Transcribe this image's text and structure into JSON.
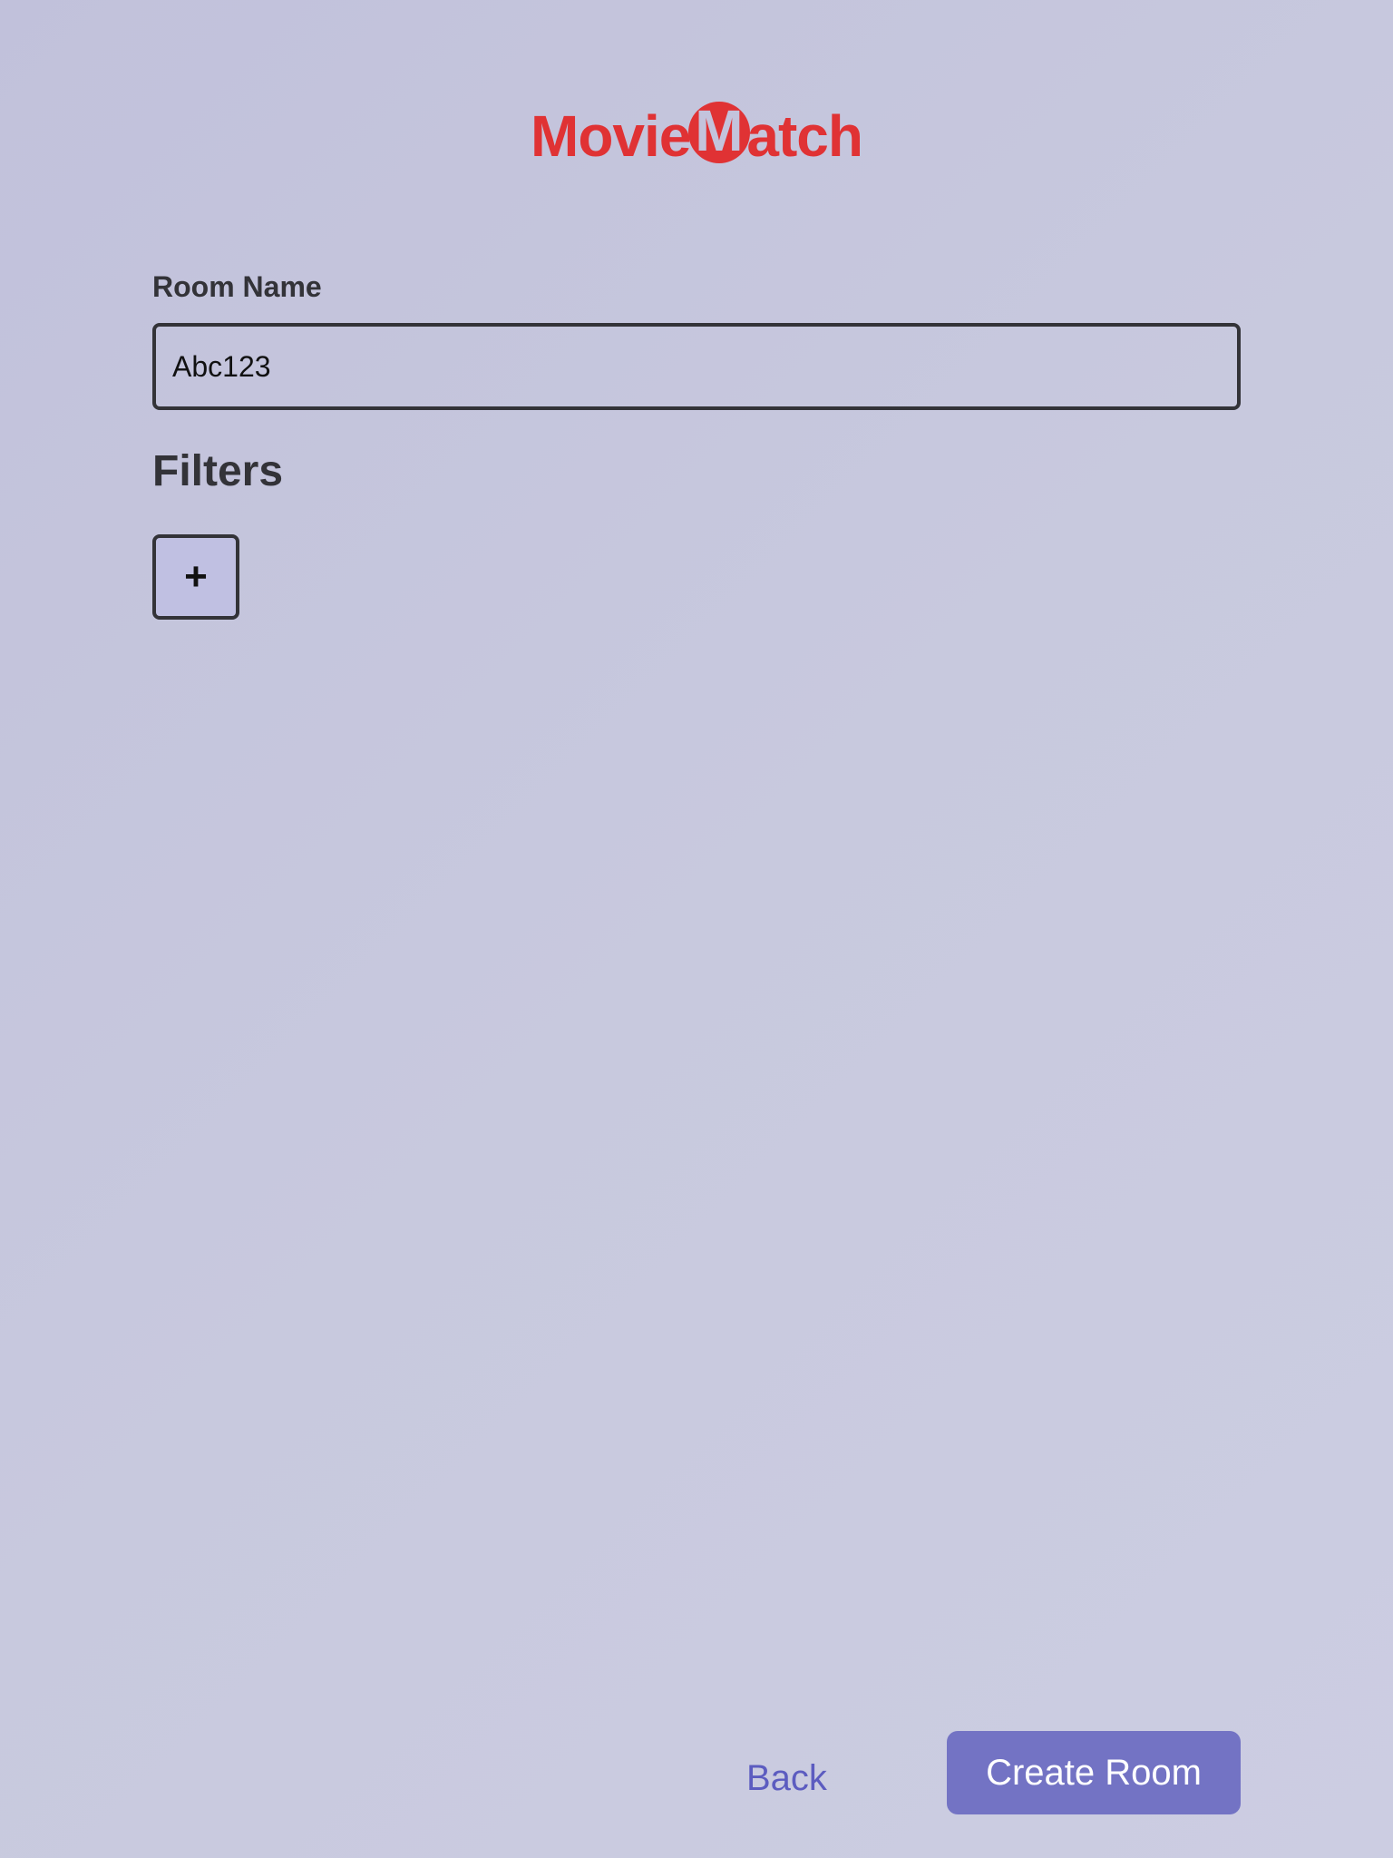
{
  "app": {
    "logo_before": "Movie",
    "logo_circle_letter": "M",
    "logo_after": "atch",
    "brand_color": "#e03234"
  },
  "form": {
    "room_name_label": "Room Name",
    "room_name_value": "Abc123",
    "filters_heading": "Filters",
    "add_filter_label": "+"
  },
  "actions": {
    "back_label": "Back",
    "create_label": "Create Room",
    "accent_color": "#7373c4",
    "link_color": "#5c5cc0"
  }
}
